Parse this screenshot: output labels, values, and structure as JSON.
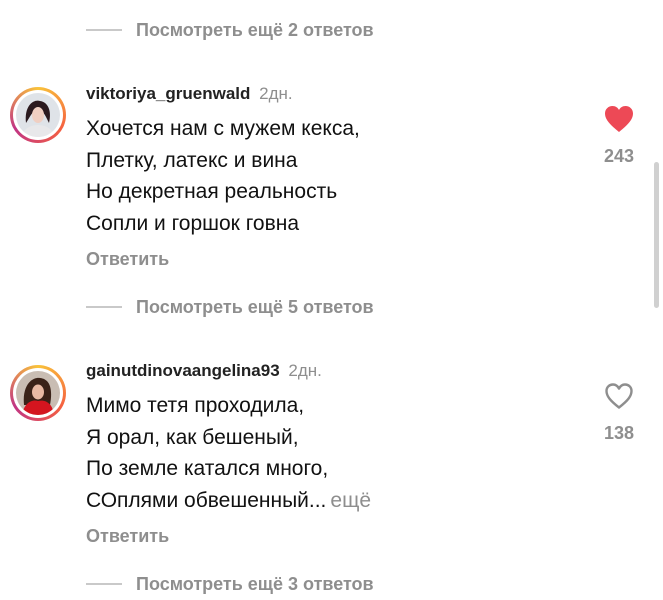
{
  "thread": {
    "view_more_top": "Посмотреть ещё 2 ответов",
    "view_more_middle": "Посмотреть ещё 5 ответов",
    "view_more_bottom": "Посмотреть ещё 3 ответов"
  },
  "comments": [
    {
      "username": "viktoriya_gruenwald",
      "time": "2дн.",
      "lines": [
        "Хочется нам с мужем кекса,",
        "Плетку, латекс и вина",
        "Но декретная реальность",
        "Сопли и горшок говна"
      ],
      "reply_label": "Ответить",
      "likes": "243",
      "liked": true
    },
    {
      "username": "gainutdinovaangelina93",
      "time": "2дн.",
      "lines": [
        "Мимо тетя проходила,",
        "Я орал, как бешеный,",
        "По земле катался много,",
        "СОплями обвешенный..."
      ],
      "more_label": "ещё",
      "reply_label": "Ответить",
      "likes": "138",
      "liked": false
    }
  ],
  "colors": {
    "like_red": "#ed4956",
    "muted": "#8e8e8e"
  }
}
